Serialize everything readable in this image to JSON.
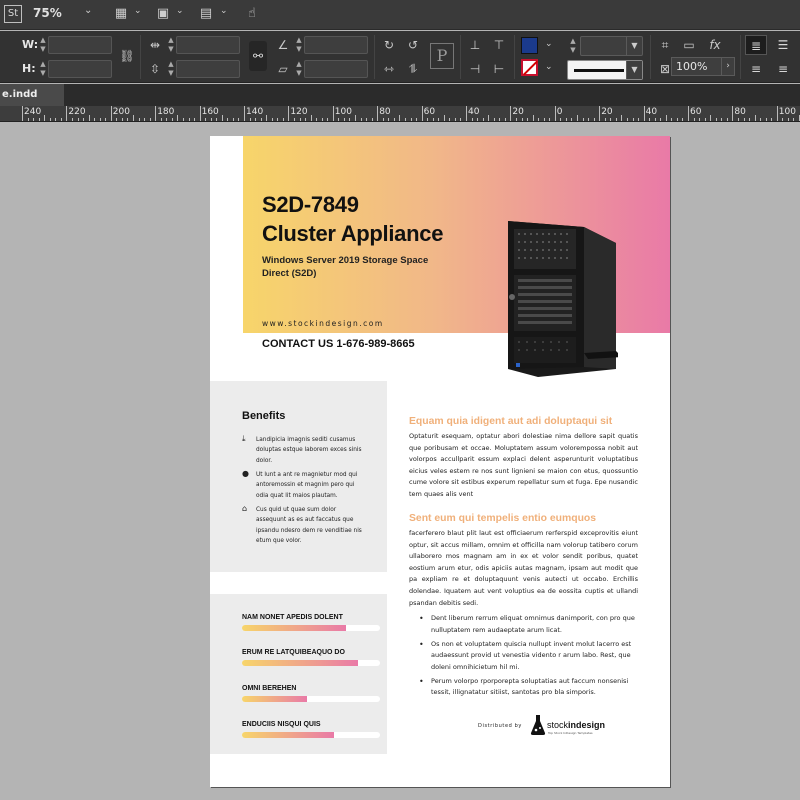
{
  "app": {
    "logo_text": "St",
    "zoom_value": "75%",
    "document_tab": "e.indd"
  },
  "control_panel": {
    "w_label": "W:",
    "h_label": "H:",
    "stroke_scale": "100%"
  },
  "ruler_numbers": [
    "240",
    "220",
    "200",
    "180",
    "160",
    "140",
    "120",
    "100",
    "80",
    "60",
    "40",
    "20",
    "0",
    "20",
    "40",
    "60",
    "80",
    "100"
  ],
  "document": {
    "title_line1": "S2D-7849",
    "title_line2": "Cluster Appliance",
    "subtitle": "Windows Server 2019 Storage Space Direct (S2D)",
    "website": "www.stockindesign.com",
    "contact": "CONTACT US 1-676-989-8665",
    "benefits": {
      "title": "Benefits",
      "items": [
        "Landipicia imagnis sediti cusamus doluptas estque laborem exces sinis dolor.",
        "Ut lunt a ant re magnietur mod qui antoremossin et magnim pero qui odia quat lit maios plautam.",
        "Cus quid ut quae sum dolor assequunt as es aut faccatus que ipsandu ndesro dem re venditiae nis etum que volor."
      ]
    },
    "skills": [
      {
        "label": "NAM NONET APEDIS DOLENT",
        "level": 0.75
      },
      {
        "label": "ERUM RE LATQUIBEAQUO DO",
        "level": 0.84
      },
      {
        "label": "OMNI BEREHEN",
        "level": 0.47
      },
      {
        "label": "ENDUCIIS NISQUI QUIS",
        "level": 0.67
      }
    ],
    "section1": {
      "heading": "Equam quia idigent aut adi doluptaqui sit",
      "body": "Optaturit esequam, optatur abori dolestiae nima dellore sapit quatis que poribusam et occae. Moluptatem assum volorempossa nobit aut volorpos accullparit essum explaci delent asperunturit voluptatibus eicius veles estem re nos sunt lignieni se maion con etus, quossuntio cume volore sit estibus experum repellatur sum et fuga. Epe nusandic tem quaes alis vent"
    },
    "section2": {
      "heading": "Sent eum qui tempelis entio eumquos",
      "body": "facerferero blaut plit laut est officiaerum rerferspid exceprovitis eiunt optur, sit accus millam, omnim et officilla nam volorup tatibero corum ullaborero mos magnam am in ex et volor sendit poribus, quatet eostium arum etur, odis apiciis autas magnam, ipsam aut modit que pa expliam re et doluptaquunt venis autecti ut occabo. Erchillis dolendae. Iquatem aut vent voluptius ea de eossita cuptis et ullandi psandan debitis sedi.",
      "bullets": [
        "Dent liberum rerrum eliquat omnimus danimporit, con pro que nulluptatem rem audaeptate arum licat.",
        "Os non et voluptatem quiscia nullupt invent molut lacerro est audaessunt provid ut venestia vidento r arum labo. Rest, que doleni omnihicietum hil mi.",
        "Perum volorpo rporporepta soluptatias aut faccum nonsenisi tessit, illignatatur sitiist, santotas pro bla simporis."
      ]
    },
    "distributed_by": "Distributed by",
    "brand_word_a": "stock",
    "brand_word_b": "indesign",
    "brand_tag": "Top Stock InDesign Templates"
  },
  "colors": {
    "gradient_start": "#f7d56a",
    "gradient_end": "#e97aa7",
    "heading_accent": "#f0b07a",
    "fill_swatch": "#1b3a8c",
    "stroke_swatch": "#d40000"
  }
}
